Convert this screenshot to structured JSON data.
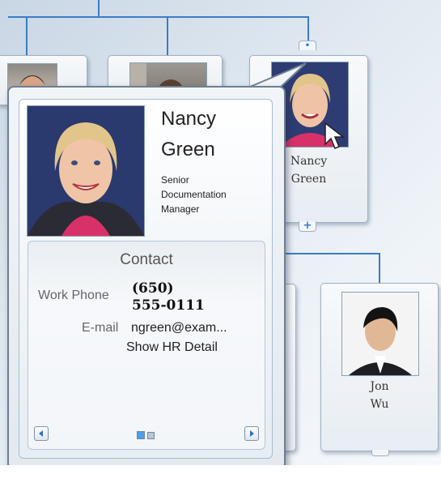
{
  "colors": {
    "connector": "#3b7cc7",
    "accent": "#2f78d0"
  },
  "popup": {
    "first_name": "Nancy",
    "last_name": "Green",
    "title_lines": [
      "Senior",
      "Documentation",
      "Manager"
    ],
    "contact": {
      "header": "Contact",
      "work_phone_label": "Work Phone",
      "work_phone_line1": "(650)",
      "work_phone_line2": "555-0111",
      "email_label": "E-mail",
      "email_value": "ngreen@exam...",
      "hr_link": "Show HR Detail"
    },
    "pager": {
      "prev_icon": "triangle-left-icon",
      "next_icon": "triangle-right-icon",
      "pages": 2,
      "current_page": 1
    }
  },
  "nodes": {
    "nancy": {
      "first": "Nancy",
      "last": "Green"
    },
    "jon": {
      "first": "Jon",
      "last": "Wu"
    }
  },
  "expanders": {
    "nancy_bottom": "+"
  }
}
